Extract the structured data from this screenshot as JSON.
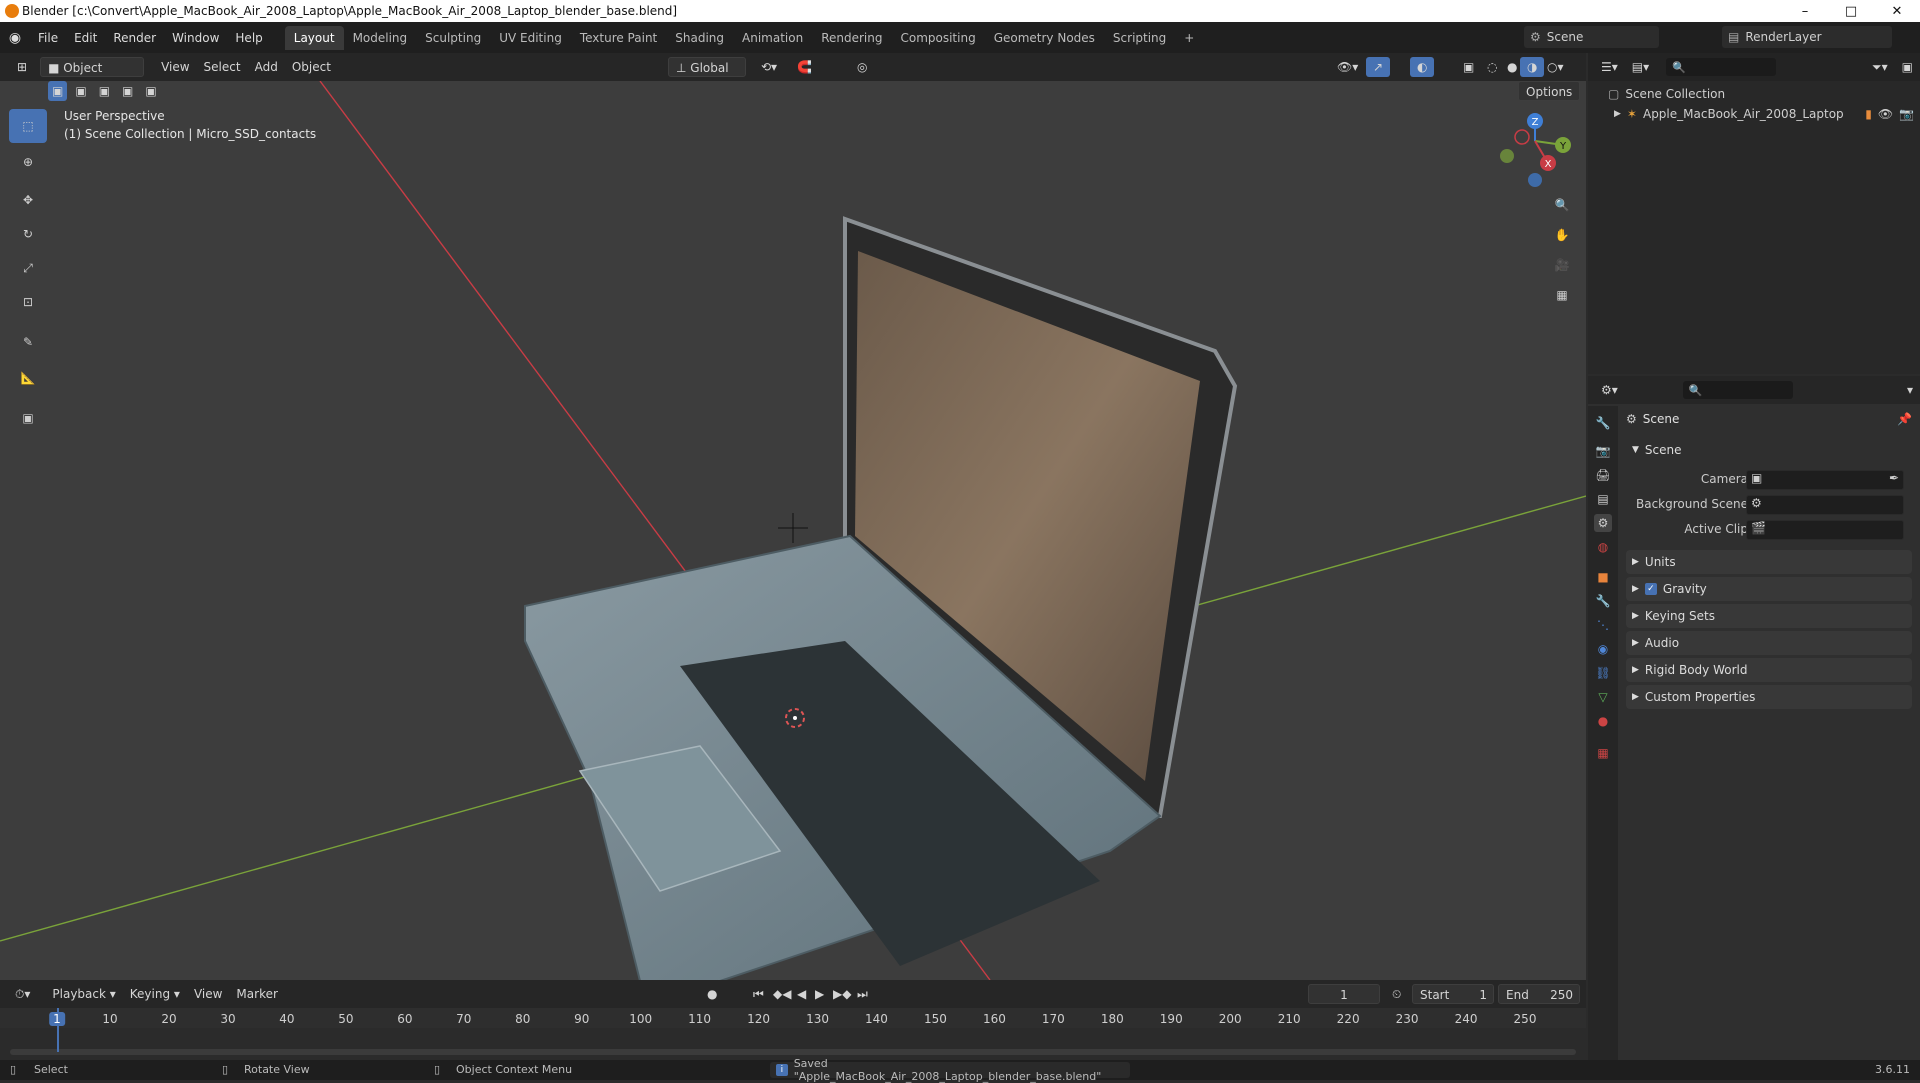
{
  "window": {
    "title": "Blender [c:\\Convert\\Apple_MacBook_Air_2008_Laptop\\Apple_MacBook_Air_2008_Laptop_blender_base.blend]",
    "minimize": "–",
    "maximize": "□",
    "close": "✕"
  },
  "menubar": [
    "File",
    "Edit",
    "Render",
    "Window",
    "Help"
  ],
  "workspaces": [
    "Layout",
    "Modeling",
    "Sculpting",
    "UV Editing",
    "Texture Paint",
    "Shading",
    "Animation",
    "Rendering",
    "Compositing",
    "Geometry Nodes",
    "Scripting",
    "+"
  ],
  "active_workspace": "Layout",
  "scene_name": "Scene",
  "view_layer": "RenderLayer",
  "viewport_header": {
    "mode": "Object Mode",
    "menus": [
      "View",
      "Select",
      "Add",
      "Object"
    ],
    "orientation": "Global",
    "options": "Options"
  },
  "viewport": {
    "perspective": "User Perspective",
    "collection_info": "(1) Scene Collection | Micro_SSD_contacts",
    "gizmo": {
      "x": "X",
      "y": "Y",
      "z": "Z"
    }
  },
  "tools": [
    "select-box",
    "cursor",
    "move",
    "rotate",
    "scale",
    "transform",
    "annotate",
    "measure",
    "add-cube"
  ],
  "outliner": {
    "root": "Scene Collection",
    "items": [
      {
        "name": "Apple_MacBook_Air_2008_Laptop"
      }
    ]
  },
  "properties": {
    "header": "Scene",
    "panel_scene": "Scene",
    "camera_label": "Camera",
    "background_scene_label": "Background Scene",
    "active_clip_label": "Active Clip",
    "panels": [
      "Units",
      "Gravity",
      "Keying Sets",
      "Audio",
      "Rigid Body World",
      "Custom Properties"
    ],
    "gravity_checked": true
  },
  "timeline": {
    "menus": [
      "Playback",
      "Keying",
      "View",
      "Marker"
    ],
    "current_frame": "1",
    "start_label": "Start",
    "start": "1",
    "end_label": "End",
    "end": "250",
    "ticks": [
      "1",
      "10",
      "20",
      "30",
      "40",
      "50",
      "60",
      "70",
      "80",
      "90",
      "100",
      "110",
      "120",
      "130",
      "140",
      "150",
      "160",
      "170",
      "180",
      "190",
      "200",
      "210",
      "220",
      "230",
      "240",
      "250"
    ]
  },
  "statusbar": {
    "select": "Select",
    "rotate": "Rotate View",
    "context": "Object Context Menu",
    "message": "Saved \"Apple_MacBook_Air_2008_Laptop_blender_base.blend\"",
    "version": "3.6.11"
  },
  "colors": {
    "accent": "#4772b3",
    "x_axis": "#c83c45",
    "y_axis": "#7aa33a",
    "z_axis": "#3f7fd6",
    "blender_orange": "#e87d0d"
  }
}
